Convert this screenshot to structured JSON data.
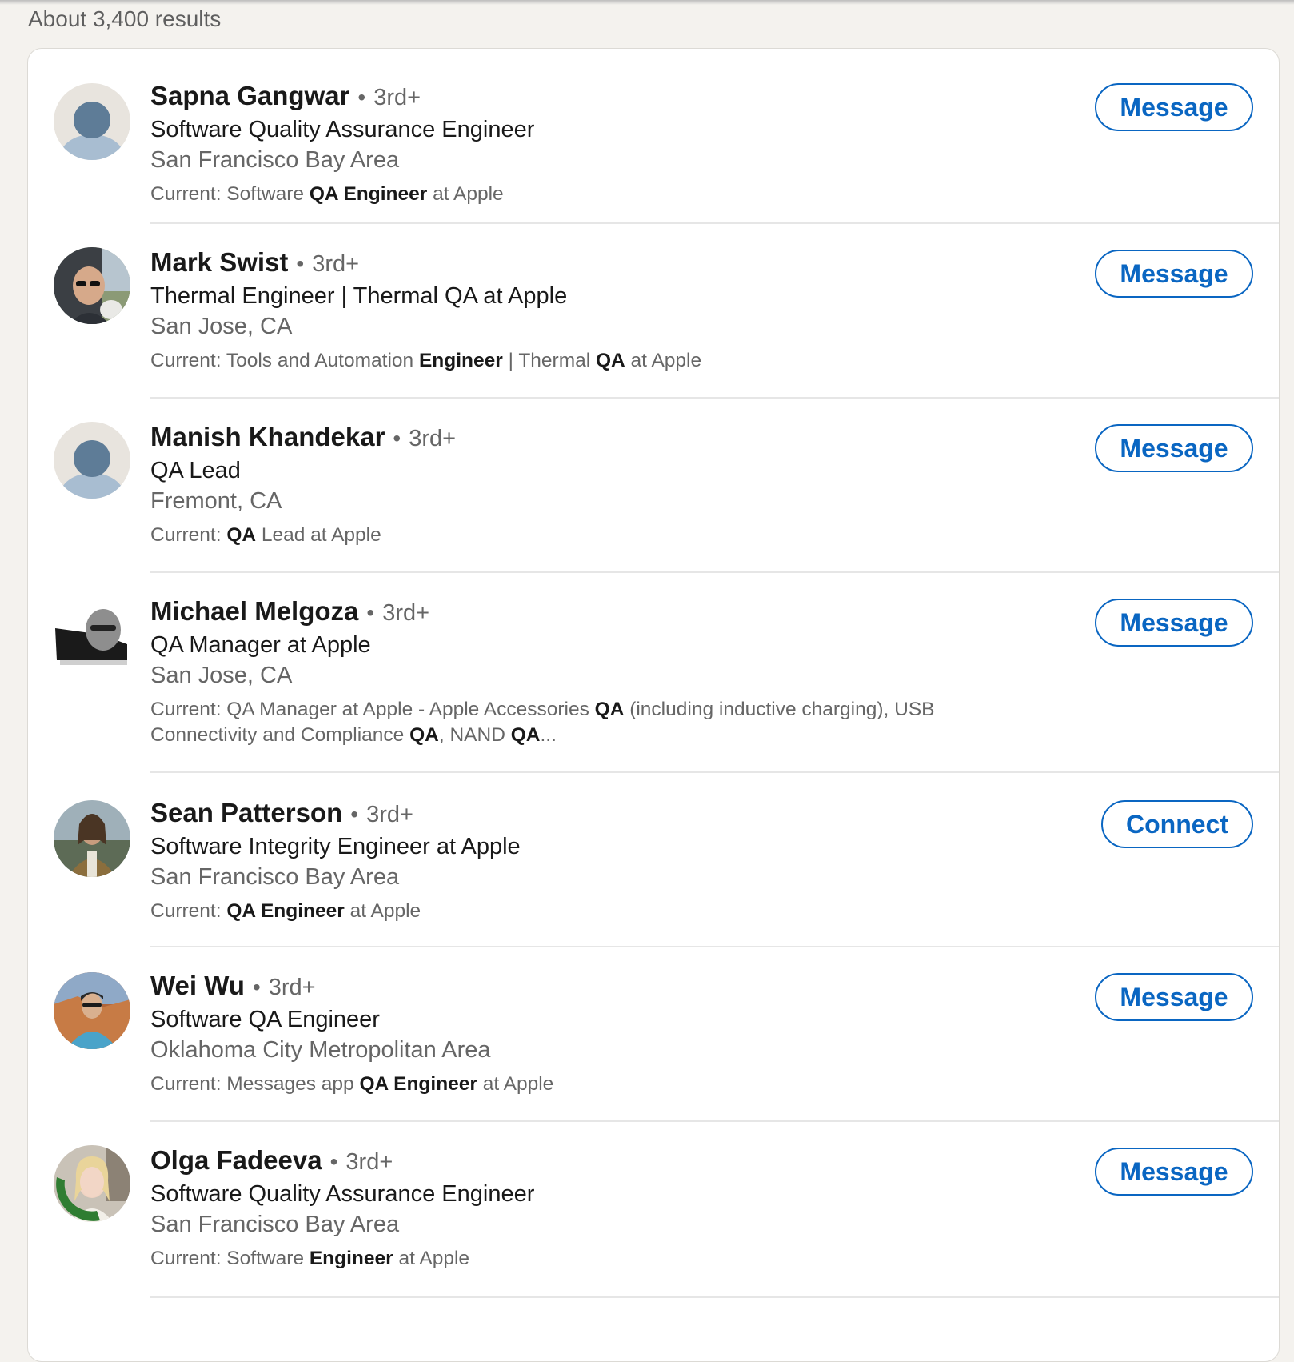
{
  "search": {
    "results_count": "About 3,400 results"
  },
  "results": [
    {
      "name": "Sapna Gangwar",
      "degree": "3rd+",
      "headline": "Software Quality Assurance Engineer",
      "location": "San Francisco Bay Area",
      "current_segments": [
        {
          "text": "Current: Software ",
          "bold": false
        },
        {
          "text": "QA Engineer",
          "bold": true
        },
        {
          "text": " at Apple",
          "bold": false
        }
      ],
      "action": "Message",
      "avatar": "default-avatar-icon"
    },
    {
      "name": "Mark Swist",
      "degree": "3rd+",
      "headline": "Thermal Engineer | Thermal QA at Apple",
      "location": "San Jose, CA",
      "current_segments": [
        {
          "text": "Current: Tools and Automation ",
          "bold": false
        },
        {
          "text": "Engineer",
          "bold": true
        },
        {
          "text": " | Thermal ",
          "bold": false
        },
        {
          "text": "QA",
          "bold": true
        },
        {
          "text": " at Apple",
          "bold": false
        }
      ],
      "action": "Message",
      "avatar": "profile-photo"
    },
    {
      "name": "Manish Khandekar",
      "degree": "3rd+",
      "headline": "QA Lead",
      "location": "Fremont, CA",
      "current_segments": [
        {
          "text": "Current: ",
          "bold": false
        },
        {
          "text": "QA",
          "bold": true
        },
        {
          "text": " Lead at Apple",
          "bold": false
        }
      ],
      "action": "Message",
      "avatar": "default-avatar-icon"
    },
    {
      "name": "Michael Melgoza",
      "degree": "3rd+",
      "headline": "QA Manager at Apple",
      "location": "San Jose, CA",
      "current_segments": [
        {
          "text": "Current: QA Manager at Apple - Apple Accessories ",
          "bold": false
        },
        {
          "text": "QA",
          "bold": true
        },
        {
          "text": " (including inductive charging), USB Connectivity and Compliance ",
          "bold": false
        },
        {
          "text": "QA",
          "bold": true
        },
        {
          "text": ", NAND ",
          "bold": false
        },
        {
          "text": "QA",
          "bold": true
        },
        {
          "text": "...",
          "bold": false
        }
      ],
      "action": "Message",
      "avatar": "profile-photo"
    },
    {
      "name": "Sean Patterson",
      "degree": "3rd+",
      "headline": "Software Integrity Engineer at Apple",
      "location": "San Francisco Bay Area",
      "current_segments": [
        {
          "text": "Current: ",
          "bold": false
        },
        {
          "text": "QA Engineer",
          "bold": true
        },
        {
          "text": " at Apple",
          "bold": false
        }
      ],
      "action": "Connect",
      "avatar": "profile-photo"
    },
    {
      "name": "Wei Wu",
      "degree": "3rd+",
      "headline": "Software QA Engineer",
      "location": "Oklahoma City Metropolitan Area",
      "current_segments": [
        {
          "text": "Current: Messages app ",
          "bold": false
        },
        {
          "text": "QA Engineer",
          "bold": true
        },
        {
          "text": " at Apple",
          "bold": false
        }
      ],
      "action": "Message",
      "avatar": "profile-photo"
    },
    {
      "name": "Olga Fadeeva",
      "degree": "3rd+",
      "headline": "Software Quality Assurance Engineer",
      "location": "San Francisco Bay Area",
      "current_segments": [
        {
          "text": "Current: Software ",
          "bold": false
        },
        {
          "text": "Engineer",
          "bold": true
        },
        {
          "text": " at Apple",
          "bold": false
        }
      ],
      "action": "Message",
      "avatar": "profile-photo",
      "avatar_badge": "#OPENTOWORK"
    }
  ],
  "colors": {
    "accent": "#0a66c2",
    "background": "#f4f2ee",
    "card": "#ffffff",
    "secondary_text": "#666666"
  }
}
